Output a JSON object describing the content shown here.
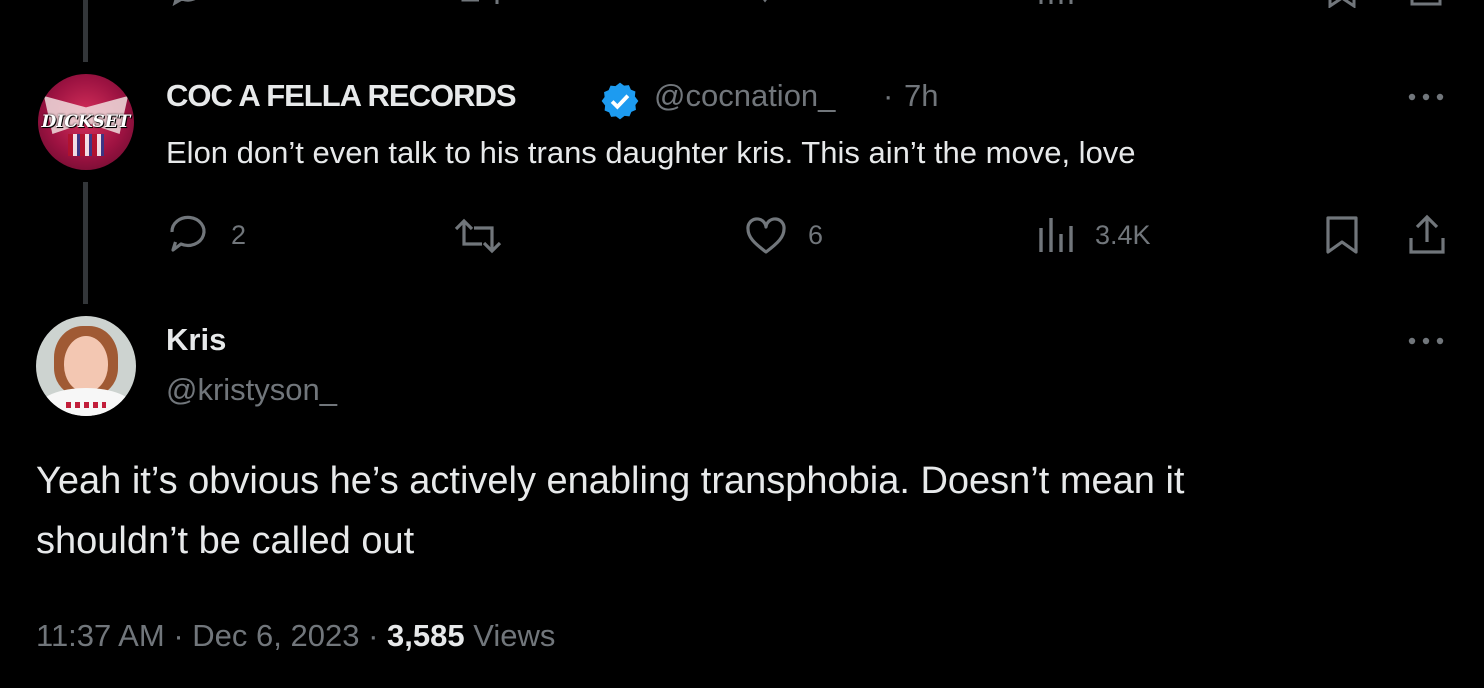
{
  "parent_tweet": {
    "display_name": "COC A FELLA RECORDS",
    "verified": true,
    "handle": "@cocnation_",
    "time_separator": "·",
    "time": "7h",
    "text": "Elon don’t even talk to his trans daughter kris. This ain’t the move, love",
    "avatar_text": "DICKSET",
    "actions": {
      "reply_count": "2",
      "retweet_count": "",
      "like_count": "6",
      "views_count": "3.4K"
    },
    "icons": [
      "reply-icon",
      "retweet-icon",
      "like-icon",
      "views-icon",
      "bookmark-icon",
      "share-icon",
      "more-icon"
    ]
  },
  "main_tweet": {
    "display_name": "Kris",
    "handle": "@kristyson_",
    "text_line1": "Yeah it’s obvious he’s actively enabling transphobia. Doesn’t mean it",
    "text_line2": "shouldn’t be called out",
    "time": "11:37 AM",
    "date": "Dec 6, 2023",
    "views_number": "3,585",
    "views_label": "Views",
    "separator": "·"
  },
  "colors": {
    "background": "#000000",
    "text_primary": "#e7e9ea",
    "text_secondary": "#71767b",
    "verified_badge": "#1d9bf0",
    "thread_line": "#333639"
  }
}
